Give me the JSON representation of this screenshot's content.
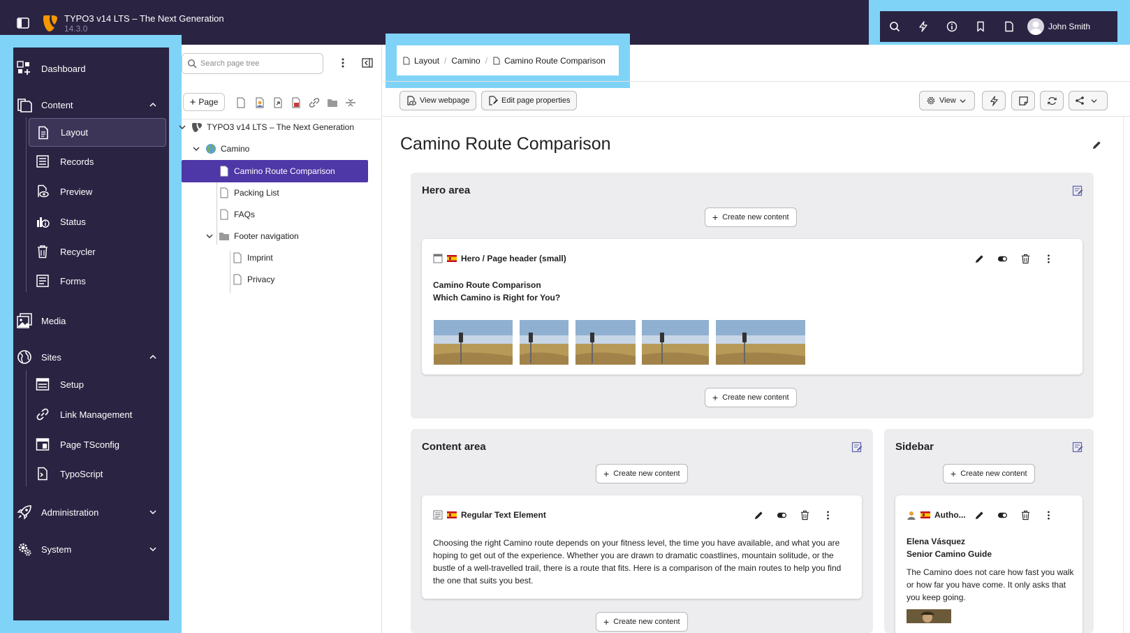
{
  "topbar": {
    "title": "TYPO3 v14 LTS – The Next Generation",
    "version": "14.3.0",
    "user_name": "John Smith"
  },
  "sidebar": {
    "dashboard": "Dashboard",
    "content": "Content",
    "content_items": [
      "Layout",
      "Records",
      "Preview",
      "Status",
      "Recycler",
      "Forms"
    ],
    "media": "Media",
    "sites": "Sites",
    "sites_items": [
      "Setup",
      "Link Management",
      "Page TSconfig",
      "TypoScript"
    ],
    "administration": "Administration",
    "system": "System"
  },
  "tree": {
    "search_placeholder": "Search page tree",
    "new_page_label": "Page",
    "root": "TYPO3 v14 LTS – The Next Generation",
    "site": "Camino",
    "pages": [
      "Camino Route Comparison",
      "Packing List",
      "FAQs"
    ],
    "folder": "Footer navigation",
    "folder_pages": [
      "Imprint",
      "Privacy"
    ]
  },
  "breadcrumb": [
    "Layout",
    "Camino",
    "Camino Route Comparison"
  ],
  "toolbar": {
    "view_webpage": "View webpage",
    "edit_page_properties": "Edit page properties",
    "view": "View"
  },
  "page_title": "Camino Route Comparison",
  "create_label": "Create new content",
  "hero": {
    "title": "Hero area",
    "element_title": "Hero / Page header (small)",
    "heading": "Camino Route Comparison",
    "subheading": "Which Camino is Right for You?"
  },
  "content_area": {
    "title": "Content area",
    "element_title": "Regular Text Element",
    "body": "Choosing the right Camino route depends on your fitness level, the time you have available, and what you are hoping to get out of the experience. Whether you are drawn to dramatic coastlines, mountain solitude, or the bustle of a well-travelled trail, there is a route that fits. Here is a comparison of the main routes to help you find the one that suits you best."
  },
  "sidebar_area": {
    "title": "Sidebar",
    "element_title": "Autho...",
    "name": "Elena Vásquez",
    "role": "Senior Camino Guide",
    "quote": "The Camino does not care how fast you walk or how far you have come. It only asks that you keep going."
  },
  "colors": {
    "topbar_bg": "#2a2342",
    "highlight": "#7fd3f7",
    "selected_node": "#4e37a6",
    "area_bg": "#edecef"
  }
}
